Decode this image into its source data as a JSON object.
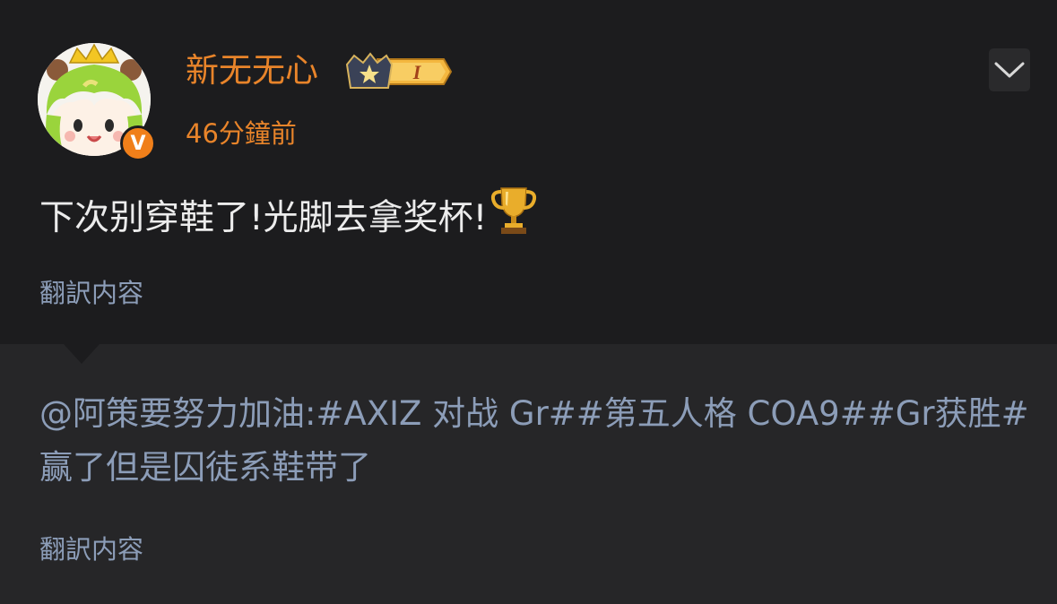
{
  "post": {
    "username": "新无无心",
    "rank_badge": {
      "numeral": "I",
      "icon": "crown-star-badge-icon"
    },
    "timestamp": "46分鐘前",
    "verified_mark": "V",
    "content": "下次别穿鞋了!光脚去拿奖杯!",
    "content_emoji": "trophy-icon",
    "translate_label": "翻訳内容"
  },
  "repost": {
    "mention": "@阿策要努力加油",
    "separator": ":",
    "text": "#AXIZ 对战 Gr##第五人格 COA9##Gr获胜#赢了但是囚徒系鞋带了",
    "translate_label": "翻訳内容"
  },
  "colors": {
    "background": "#1c1c1e",
    "repost_background": "#262628",
    "username": "#e8842a",
    "link": "#8c9db8",
    "text": "#ececec",
    "verified": "#f07f1a"
  }
}
